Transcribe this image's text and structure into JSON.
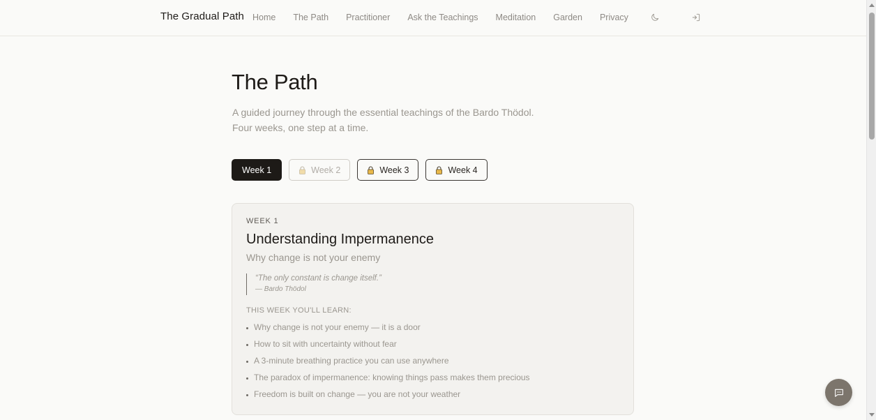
{
  "header": {
    "brand": "The Gradual Path",
    "nav": [
      {
        "label": "Home"
      },
      {
        "label": "The Path"
      },
      {
        "label": "Practitioner"
      },
      {
        "label": "Ask the Teachings"
      },
      {
        "label": "Meditation"
      },
      {
        "label": "Garden"
      },
      {
        "label": "Privacy"
      }
    ],
    "icons": {
      "theme": "moon-icon",
      "login": "sign-in-icon"
    }
  },
  "page": {
    "title": "The Path",
    "subtitle_line1": "A guided journey through the essential teachings of the Bardo Thödol.",
    "subtitle_line2": "Four weeks, one step at a time."
  },
  "tabs": [
    {
      "label": "Week 1",
      "state": "active"
    },
    {
      "label": "Week 2",
      "state": "locked-disabled",
      "icon": "lock-icon"
    },
    {
      "label": "Week 3",
      "state": "locked",
      "icon": "lock-icon"
    },
    {
      "label": "Week 4",
      "state": "locked",
      "icon": "lock-icon"
    }
  ],
  "week": {
    "eyebrow": "WEEK 1",
    "title": "Understanding Impermanence",
    "subtitle": "Why change is not your enemy",
    "quote": "“The only constant is change itself.”",
    "quote_cite": "— Bardo Thödol",
    "learn_heading": "THIS WEEK YOU'LL LEARN:",
    "learn_items": [
      "Why change is not your enemy — it is a door",
      "How to sit with uncertainty without fear",
      "A 3-minute breathing practice you can use anywhere",
      "The paradox of impermanence: knowing things pass makes them precious",
      "Freedom is built on change — you are not your weather"
    ]
  },
  "colors": {
    "background": "#fafaf8",
    "ink": "#1d1a17",
    "muted": "#9a968f",
    "card": "#f3f2ef",
    "lock": "#e8b84a",
    "fab": "#7c756c"
  },
  "chat": {
    "icon": "chat-icon"
  }
}
